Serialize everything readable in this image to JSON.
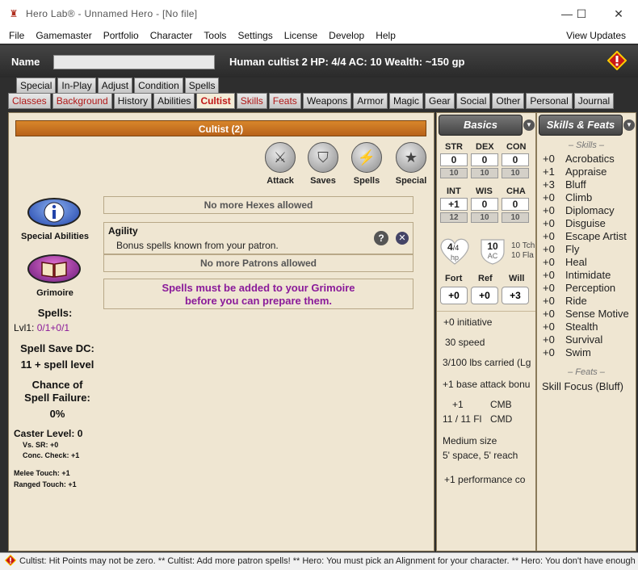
{
  "window": {
    "title": "Hero Lab®  -  Unnamed Hero  -  [No file]",
    "min": "—",
    "max": "☐",
    "close": "✕"
  },
  "menu": [
    "File",
    "Gamemaster",
    "Portfolio",
    "Character",
    "Tools",
    "Settings",
    "License",
    "Develop",
    "Help"
  ],
  "menu_right": "View Updates",
  "name_label": "Name",
  "name_value": "",
  "summary": "Human cultist 2  HP: 4/4  AC: 10  Wealth: ~150 gp",
  "tabs_top": [
    "Special",
    "In-Play",
    "Adjust",
    "Condition",
    "Spells"
  ],
  "tabs_bottom": [
    "Classes",
    "Background",
    "History",
    "Abilities",
    "Cultist",
    "Skills",
    "Feats",
    "Weapons",
    "Armor",
    "Magic",
    "Gear",
    "Social",
    "Other",
    "Personal",
    "Journal"
  ],
  "class_header": "Cultist (2)",
  "big_buttons": [
    "Attack",
    "Saves",
    "Spells",
    "Special"
  ],
  "hexes_msg": "No more Hexes allowed",
  "agility": {
    "title": "Agility",
    "desc": "Bonus spells known from your patron."
  },
  "patrons_msg": "No more Patrons allowed",
  "grimoire_msg": [
    "Spells must be added to your Grimoire",
    "before you can prepare them."
  ],
  "left": {
    "special_abilities": "Special Abilities",
    "grimoire": "Grimoire",
    "spells_label": "Spells:",
    "lvl1_label": "Lvl1:",
    "lvl1_value": "0/1+0/1",
    "save_dc_label": "Spell Save DC:",
    "save_dc_value": "11 + spell level",
    "chance_label1": "Chance of",
    "chance_label2": "Spell Failure:",
    "chance_value": "0%",
    "caster_level": "Caster Level: 0",
    "vs_sr": "Vs. SR: +0",
    "conc_check": "Conc. Check: +1",
    "melee_touch": "Melee Touch: +1",
    "ranged_touch": "Ranged Touch: +1"
  },
  "basics": {
    "header": "Basics",
    "stats": [
      {
        "name": "STR",
        "val": "0",
        "score": "10"
      },
      {
        "name": "DEX",
        "val": "0",
        "score": "10"
      },
      {
        "name": "CON",
        "val": "0",
        "score": "10"
      },
      {
        "name": "INT",
        "val": "+1",
        "score": "12"
      },
      {
        "name": "WIS",
        "val": "0",
        "score": "10"
      },
      {
        "name": "CHA",
        "val": "0",
        "score": "10"
      }
    ],
    "hp_val": "4",
    "hp_max": "/4",
    "hp_label": "hp",
    "ac_val": "10",
    "ac_label": "AC",
    "ac_touch": "10 Tch",
    "ac_flat": "10 Fla",
    "saves": [
      {
        "name": "Fort",
        "val": "+0"
      },
      {
        "name": "Ref",
        "val": "+0"
      },
      {
        "name": "Will",
        "val": "+3"
      }
    ],
    "initiative": "+0  initiative",
    "speed": "30  speed",
    "carried": "3/100 lbs carried (Lg",
    "bab": "+1 base attack bonu",
    "cmb_val": "+1",
    "cmb": "CMB",
    "cmd_val": "11 / 11 Fl",
    "cmd": "CMD",
    "size1": "Medium size",
    "size2": "5' space, 5' reach",
    "perform": "+1  performance co"
  },
  "skills_feats": {
    "header": "Skills & Feats",
    "skills_title": "– Skills –",
    "skills": [
      {
        "bonus": "+0",
        "name": "Acrobatics"
      },
      {
        "bonus": "+1",
        "name": "Appraise"
      },
      {
        "bonus": "+3",
        "name": "Bluff"
      },
      {
        "bonus": "+0",
        "name": "Climb"
      },
      {
        "bonus": "+0",
        "name": "Diplomacy"
      },
      {
        "bonus": "+0",
        "name": "Disguise"
      },
      {
        "bonus": "+0",
        "name": "Escape Artist"
      },
      {
        "bonus": "+0",
        "name": "Fly"
      },
      {
        "bonus": "+0",
        "name": "Heal"
      },
      {
        "bonus": "+0",
        "name": "Intimidate"
      },
      {
        "bonus": "+0",
        "name": "Perception"
      },
      {
        "bonus": "+0",
        "name": "Ride"
      },
      {
        "bonus": "+0",
        "name": "Sense Motive"
      },
      {
        "bonus": "+0",
        "name": "Stealth"
      },
      {
        "bonus": "+0",
        "name": "Survival"
      },
      {
        "bonus": "+0",
        "name": "Swim"
      }
    ],
    "feats_title": "– Feats –",
    "feat": "Skill Focus (Bluff)"
  },
  "status": "Cultist: Hit Points may not be zero. ** Cultist: Add more patron spells! ** Hero: You must pick an Alignment for your character. ** Hero: You don't have enough"
}
